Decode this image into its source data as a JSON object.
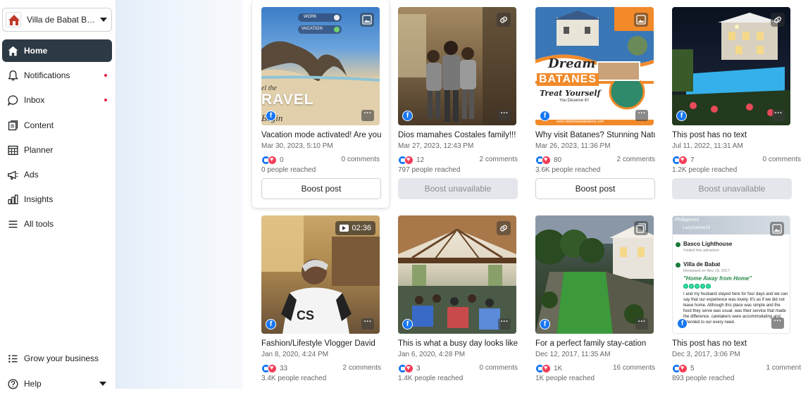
{
  "page_selector": {
    "name": "Villa de Babat Batanes"
  },
  "nav": [
    {
      "label": "Home",
      "active": true,
      "icon": "home-icon"
    },
    {
      "label": "Notifications",
      "icon": "bell-icon",
      "dot": true
    },
    {
      "label": "Inbox",
      "icon": "chat-icon",
      "dot": true
    },
    {
      "label": "Content",
      "icon": "content-icon"
    },
    {
      "label": "Planner",
      "icon": "calendar-icon"
    },
    {
      "label": "Ads",
      "icon": "megaphone-icon"
    },
    {
      "label": "Insights",
      "icon": "chart-icon"
    },
    {
      "label": "All tools",
      "icon": "menu-icon"
    }
  ],
  "footer_nav": [
    {
      "label": "Grow your business",
      "icon": "list-icon"
    },
    {
      "label": "Help",
      "icon": "help-icon"
    }
  ],
  "colors": {
    "accent": "#1877f2",
    "active_nav": "#2d3a45",
    "notification_dot": "#e41e3f"
  },
  "posts": [
    {
      "text": "Vacation mode activated! Are you ready?",
      "date": "Mar 30, 2023, 5:10 PM",
      "reactions": "0",
      "comments": "0 comments",
      "reach": "0 people reached",
      "boost": "Boost post",
      "boostable": true,
      "type_icon": "photo-icon",
      "thumb_text": "RAVEL",
      "thumb_chip_1": "WORK",
      "thumb_chip_2": "VACATION"
    },
    {
      "text": "Dios mamahes Costales family!!!",
      "date": "Mar 27, 2023, 12:43 PM",
      "reactions": "12",
      "comments": "2 comments",
      "reach": "797 people reached",
      "boost": "Boost unavailable",
      "boostable": false,
      "type_icon": "link-icon"
    },
    {
      "text": "Why visit Batanes? Stunning Nature",
      "date": "Mar 26, 2023, 11:36 PM",
      "reactions": "80",
      "comments": "2 comments",
      "reach": "3.6K people reached",
      "boost": "Boost post",
      "boostable": true,
      "type_icon": "photo-icon",
      "thumb_title": "Dream",
      "thumb_sub": "BATANES",
      "thumb_tag": "Treat Yourself",
      "thumb_small": "You Deserve it!!",
      "thumb_url": "www.villadebabatbatanes.com"
    },
    {
      "text": "This post has no text",
      "date": "Jul 11, 2022, 11:31 AM",
      "reactions": "7",
      "comments": "0 comments",
      "reach": "1.2K people reached",
      "boost": "Boost unavailable",
      "boostable": false,
      "type_icon": "link-icon"
    },
    {
      "text": "Fashion/Lifestyle Vlogger David",
      "date": "Jan 8, 2020, 4:24 PM",
      "reactions": "33",
      "comments": "2 comments",
      "reach": "3.4K people reached",
      "video_duration": "02:36"
    },
    {
      "text": "This is what a busy day looks like",
      "date": "Jan 6, 2020, 4:28 PM",
      "reactions": "3",
      "comments": "0 comments",
      "reach": "1.4K people reached",
      "type_icon": "link-icon"
    },
    {
      "text": "For a perfect family stay-cation",
      "date": "Dec 12, 2017, 11:35 AM",
      "reactions": "1K",
      "comments": "16 comments",
      "reach": "1K people reached",
      "type_icon": "album-icon"
    },
    {
      "text": "This post has no text",
      "date": "Dec 3, 2017, 3:06 PM",
      "reactions": "5",
      "comments": "1 comment",
      "reach": "893 people reached",
      "type_icon": "photo-icon",
      "review": {
        "country": "Philippines",
        "user": "LazyJoanne13",
        "place": "Basco Lighthouse",
        "place_sub": "Visited this attraction",
        "hotel": "Villa de Babat",
        "hotel_sub": "Reviewed on Nov 19, 2017",
        "title": "\"Home Away from Home\"",
        "body": "I and my husband stayed here for four days and we can say that our experience was lovely. It's as if we did not leave home. Although this place was simple and the food they serve was usual, was their service that made the difference. caretakers were accommodating and attended to our every need."
      }
    }
  ]
}
